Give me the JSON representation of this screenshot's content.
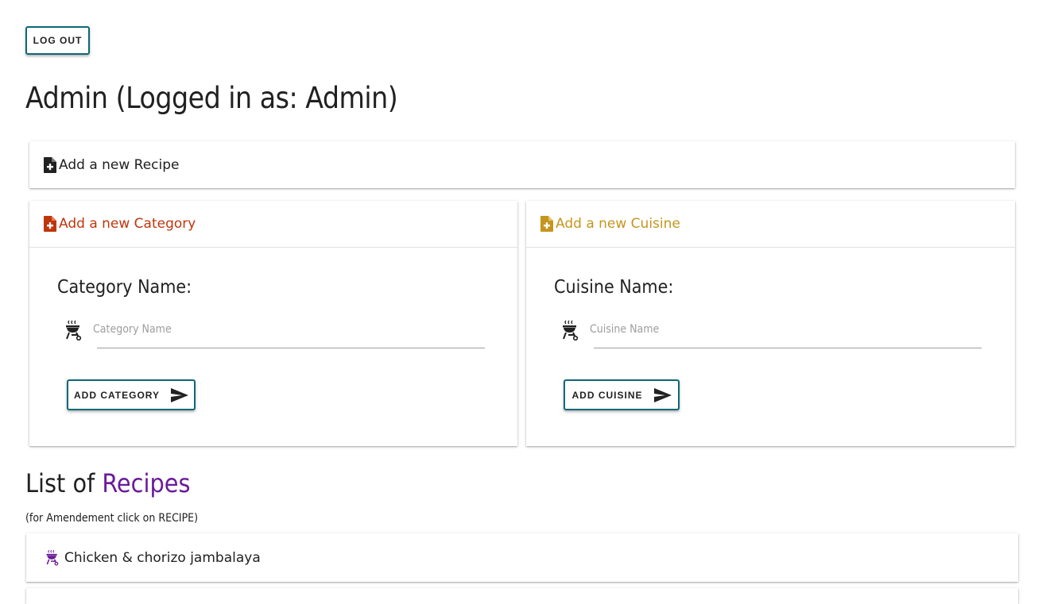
{
  "header": {
    "logout_label": "LOG OUT",
    "title": "Admin (Logged in as: Admin)"
  },
  "recipe_card": {
    "header": "Add a new Recipe",
    "icon": "file-plus-icon",
    "color": "#212121"
  },
  "category_card": {
    "header": "Add a new Category",
    "icon": "file-plus-icon",
    "color": "#bf360c",
    "form_label": "Category Name:",
    "input_placeholder": "Category Name",
    "input_value": "",
    "input_icon": "grill-icon",
    "button_label": "ADD CATEGORY",
    "button_icon": "send-icon"
  },
  "cuisine_card": {
    "header": "Add a new Cuisine",
    "icon": "file-plus-icon",
    "color": "#c5951d",
    "form_label": "Cuisine Name:",
    "input_placeholder": "Cuisine Name",
    "input_value": "",
    "input_icon": "grill-icon",
    "button_label": "ADD CUISINE",
    "button_icon": "send-icon"
  },
  "recipes_list": {
    "title_prefix": "List of",
    "title_accent": "Recipes",
    "accent_color": "#6a1b9a",
    "hint": "(for Amendement click on RECIPE)",
    "items": [
      {
        "label": "Chicken & chorizo jambalaya",
        "icon": "grill-icon"
      }
    ]
  },
  "theme": {
    "button_border": "#0e6877",
    "text": "#212121"
  }
}
